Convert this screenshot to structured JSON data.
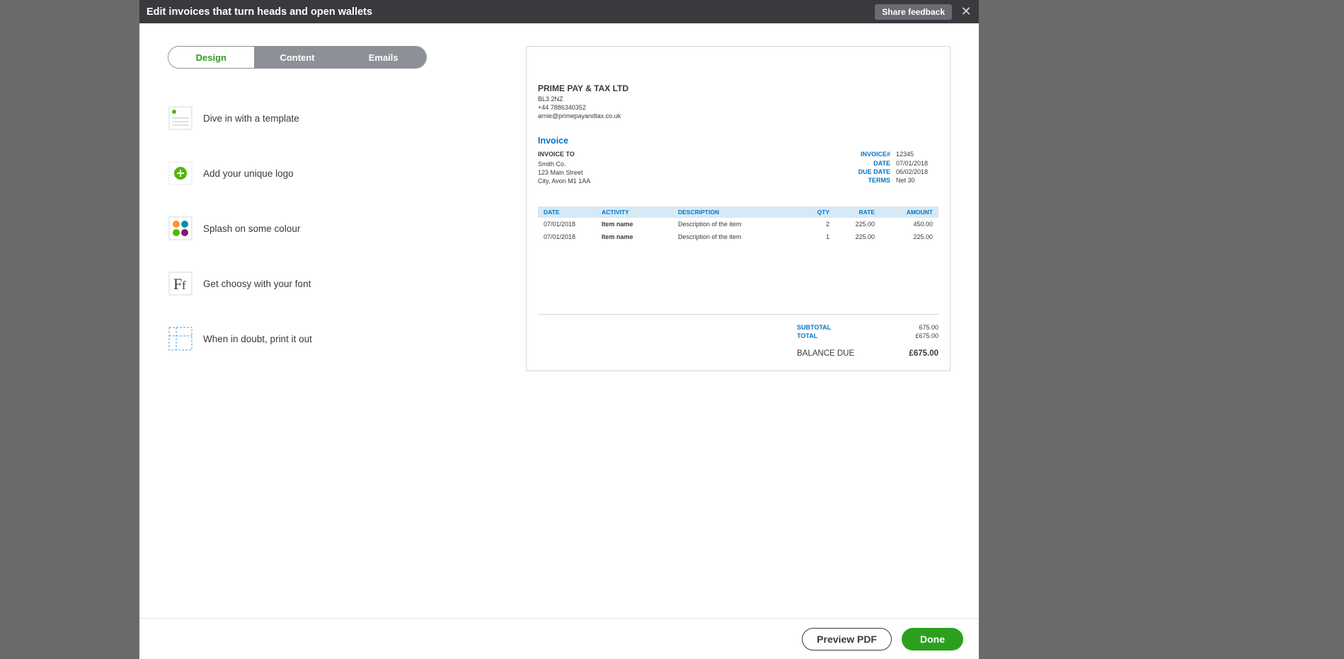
{
  "header": {
    "title": "Edit invoices that turn heads and open wallets",
    "share_label": "Share feedback"
  },
  "tabs": {
    "design": "Design",
    "content": "Content",
    "emails": "Emails"
  },
  "options": {
    "template": "Dive in with a template",
    "logo": "Add your unique logo",
    "colour": "Splash on some colour",
    "font": "Get choosy with your font",
    "print": "When in doubt, print it out"
  },
  "preview": {
    "company": {
      "name": "PRIME PAY & TAX LTD",
      "postcode": "BL3 2NZ",
      "phone": "+44 7886340352",
      "email": "arnie@primepayandtax.co.uk"
    },
    "title": "Invoice",
    "bill_to": {
      "header": "INVOICE TO",
      "name": "Smith Co.",
      "street": "123 Main Street",
      "city": "City, Avon M1 1AA"
    },
    "meta": {
      "labels": {
        "number": "INVOICE#",
        "date": "DATE",
        "due": "DUE DATE",
        "terms": "TERMS"
      },
      "number": "12345",
      "date": "07/01/2018",
      "due": "06/02/2018",
      "terms": "Net 30"
    },
    "columns": {
      "date": "DATE",
      "activity": "ACTIVITY",
      "description": "DESCRIPTION",
      "qty": "QTY",
      "rate": "RATE",
      "amount": "AMOUNT"
    },
    "rows": [
      {
        "date": "07/01/2018",
        "activity": "Item name",
        "description": "Description of the item",
        "qty": "2",
        "rate": "225.00",
        "amount": "450.00"
      },
      {
        "date": "07/01/2018",
        "activity": "Item name",
        "description": "Description of the item",
        "qty": "1",
        "rate": "225.00",
        "amount": "225.00"
      }
    ],
    "totals": {
      "subtotal_label": "SUBTOTAL",
      "subtotal": "675.00",
      "total_label": "TOTAL",
      "total": "£675.00",
      "balance_label": "BALANCE DUE",
      "balance": "£675.00"
    }
  },
  "footer": {
    "preview": "Preview PDF",
    "done": "Done"
  }
}
